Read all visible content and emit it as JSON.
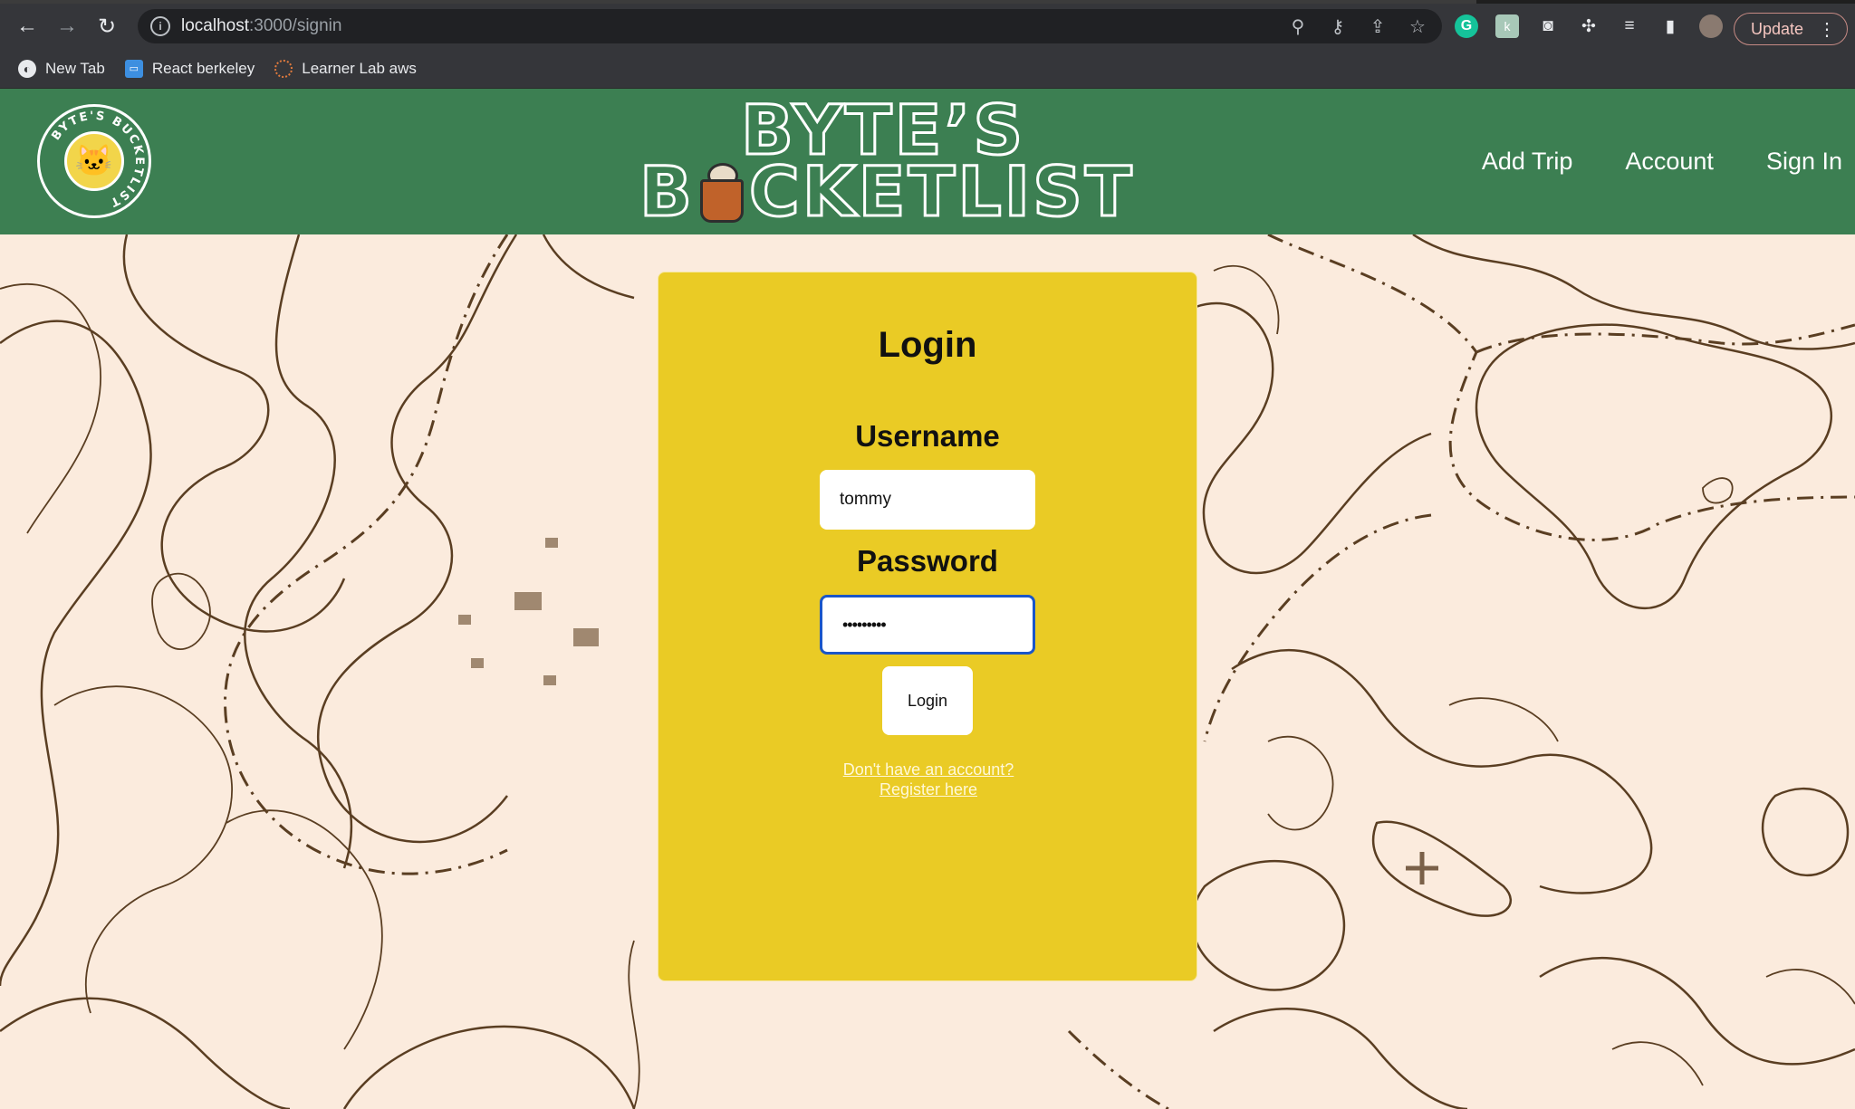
{
  "browser": {
    "url_host": "localhost",
    "url_path": ":3000/signin",
    "update_label": "Update",
    "nav": {
      "back_icon": "arrow-left-icon",
      "forward_icon": "arrow-right-icon",
      "reload_icon": "reload-icon"
    },
    "omnibox_icons": [
      "location-pin-icon",
      "key-icon",
      "share-icon",
      "star-icon"
    ],
    "extension_icons": [
      "grammarly-icon",
      "k-extension-icon",
      "camera-icon",
      "puzzle-icon",
      "media-queue-icon",
      "side-panel-icon",
      "profile-avatar"
    ],
    "bookmarks": [
      {
        "label": "New Tab",
        "icon": "globe-icon"
      },
      {
        "label": "React berkeley",
        "icon": "monitor-icon"
      },
      {
        "label": "Learner Lab aws",
        "icon": "aws-icon"
      }
    ]
  },
  "header": {
    "brand_line1": "BYTE’S",
    "brand_line2_prefix": "B",
    "brand_line2_suffix": "CKETLIST",
    "logo_text": "BYTE'S BUCKETLIST",
    "bg_color": "#3c7f52",
    "nav": [
      {
        "label": "Add Trip"
      },
      {
        "label": "Account"
      },
      {
        "label": "Sign In"
      }
    ]
  },
  "login": {
    "title": "Login",
    "username_label": "Username",
    "username_value": "tommy",
    "password_label": "Password",
    "password_value": "•••••••••",
    "button_label": "Login",
    "register_link": "Don't have an account? Register here",
    "card_color": "#eacb25"
  }
}
